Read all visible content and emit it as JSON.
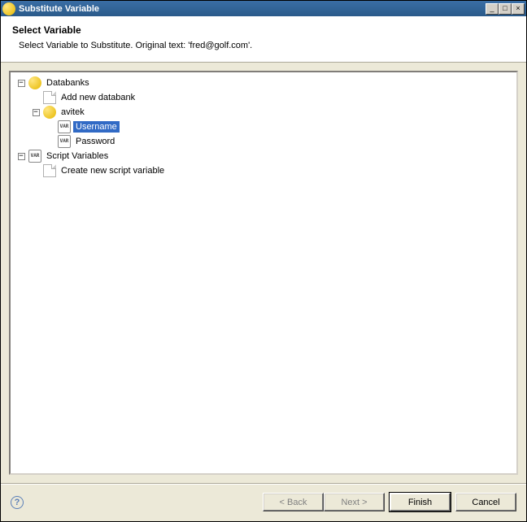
{
  "window": {
    "title": "Substitute Variable",
    "controls": {
      "min": "_",
      "max": "□",
      "close": "×"
    }
  },
  "header": {
    "heading": "Select Variable",
    "description": "Select Variable to Substitute.   Original text: 'fred@golf.com'."
  },
  "tree": {
    "databanks": {
      "label": "Databanks",
      "expanded": true,
      "add_label": "Add new databank",
      "items": [
        {
          "label": "avitek",
          "expanded": true,
          "fields": [
            {
              "label": "Username",
              "selected": true
            },
            {
              "label": "Password",
              "selected": false
            }
          ]
        }
      ]
    },
    "script_vars": {
      "label": "Script Variables",
      "expanded": true,
      "create_label": "Create new script variable"
    }
  },
  "footer": {
    "help": "?",
    "back": "< Back",
    "next": "Next >",
    "finish": "Finish",
    "cancel": "Cancel"
  }
}
